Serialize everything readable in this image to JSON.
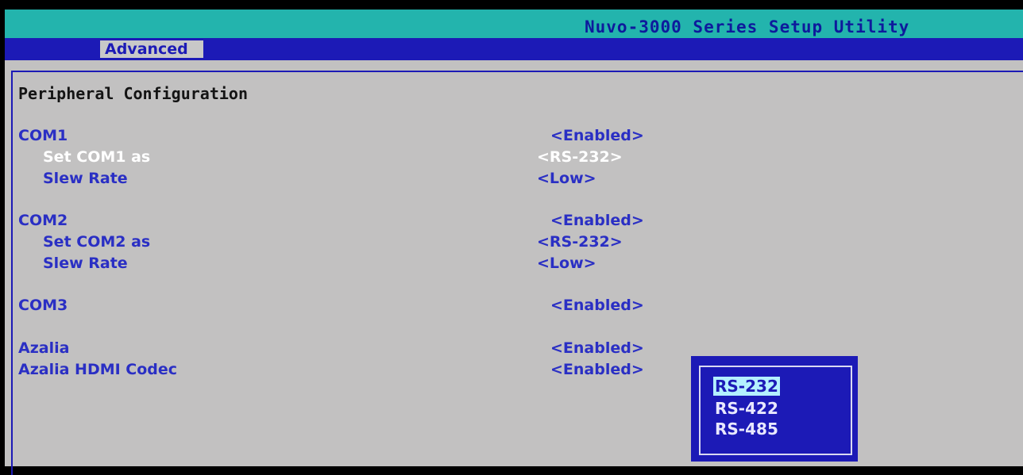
{
  "app": {
    "title": "Nuvo-3000 Series Setup Utility"
  },
  "tabs": [
    {
      "label": "Advanced",
      "active": true
    }
  ],
  "section": {
    "title": "Peripheral Configuration"
  },
  "settings": [
    {
      "label": "COM1",
      "value": "<Enabled>"
    },
    {
      "label": "Set COM1 as",
      "value": "<RS-232>"
    },
    {
      "label": "Slew Rate",
      "value": "<Low>"
    },
    {
      "label": "COM2",
      "value": "<Enabled>"
    },
    {
      "label": "Set COM2 as",
      "value": "<RS-232>"
    },
    {
      "label": "Slew Rate",
      "value": "<Low>"
    },
    {
      "label": "COM3",
      "value": "<Enabled>"
    },
    {
      "label": "Azalia",
      "value": "<Enabled>"
    },
    {
      "label": "Azalia HDMI Codec",
      "value": "<Enabled>"
    }
  ],
  "popup": {
    "options": [
      "RS-232",
      "RS-422",
      "RS-485"
    ],
    "highlighted": "RS-232"
  },
  "colors": {
    "title_bar": "#23b4ad",
    "tab_bar": "#1c1ab6",
    "panel": "#c2c1c1",
    "text_blue": "#2a2fc4",
    "highlight": "#b4f0ff"
  }
}
